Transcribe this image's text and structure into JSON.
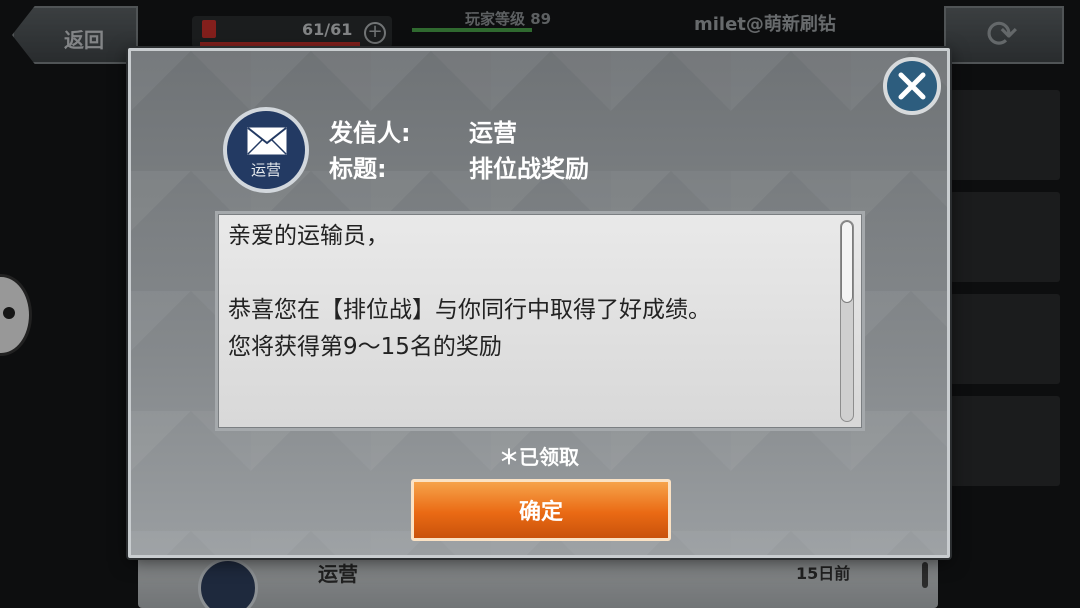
{
  "topbar": {
    "back_label": "返回",
    "fuel": "61/61",
    "fuel_add": "+",
    "player_level": "玩家等级 89",
    "account": "milet@萌新刷钻"
  },
  "list_row": {
    "sender": "运营",
    "time": "15日前"
  },
  "mail_dialog": {
    "icon_label": "运营",
    "sender_key": "发信人:",
    "sender_value": "运营",
    "subject_key": "标题:",
    "subject_value": "排位战奖励",
    "body_lines": [
      "亲爱的运输员，",
      "",
      "恭喜您在【排位战】与你同行中取得了好成绩。",
      "您将获得第9～15名的奖励"
    ],
    "status": "＊已领取",
    "confirm_label": "确定"
  },
  "colors": {
    "confirm_button": "#ea6a14",
    "close_button": "#2d5d7e",
    "mail_icon": "#233a63"
  },
  "icons": [
    "envelope-icon",
    "close-icon",
    "refresh-icon",
    "fuel-icon",
    "plus-icon"
  ]
}
